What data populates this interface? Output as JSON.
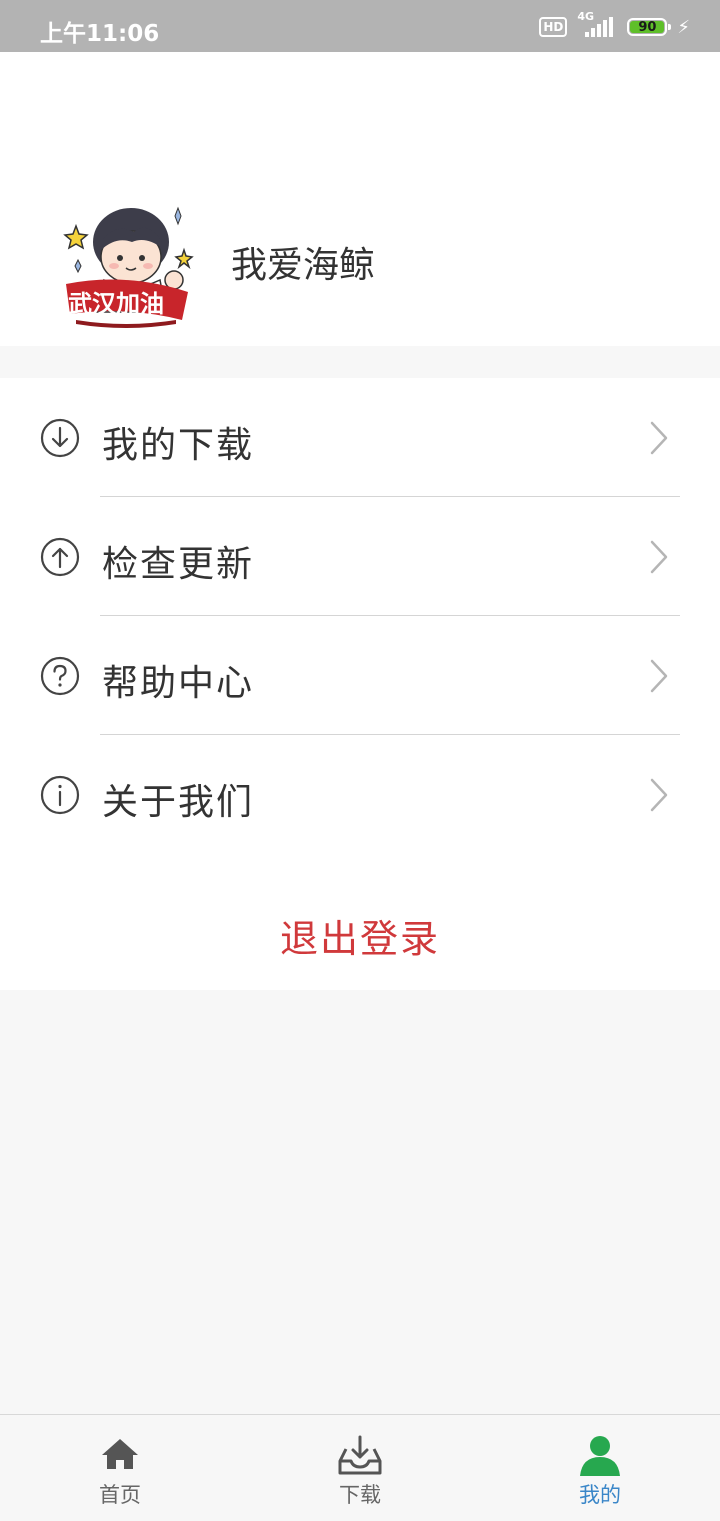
{
  "status_bar": {
    "time": "上午11:06",
    "hd": "HD",
    "network": "4G",
    "battery": "90",
    "battery_level": 90
  },
  "profile": {
    "username": "我爱海鲸",
    "avatar_caption": "武汉加油"
  },
  "menu": {
    "items": [
      {
        "label": "我的下载",
        "icon": "download-circle-icon"
      },
      {
        "label": "检查更新",
        "icon": "upload-circle-icon"
      },
      {
        "label": "帮助中心",
        "icon": "help-circle-icon"
      },
      {
        "label": "关于我们",
        "icon": "info-circle-icon"
      }
    ],
    "logout_label": "退出登录"
  },
  "tabbar": {
    "tabs": [
      {
        "label": "首页",
        "icon": "home-icon"
      },
      {
        "label": "下载",
        "icon": "inbox-download-icon"
      },
      {
        "label": "我的",
        "icon": "person-icon",
        "active": true
      }
    ]
  },
  "colors": {
    "accent_active_tab": "#3a86c8",
    "person_icon": "#27a84f",
    "logout": "#d0393b",
    "background": "#f7f7f7"
  }
}
